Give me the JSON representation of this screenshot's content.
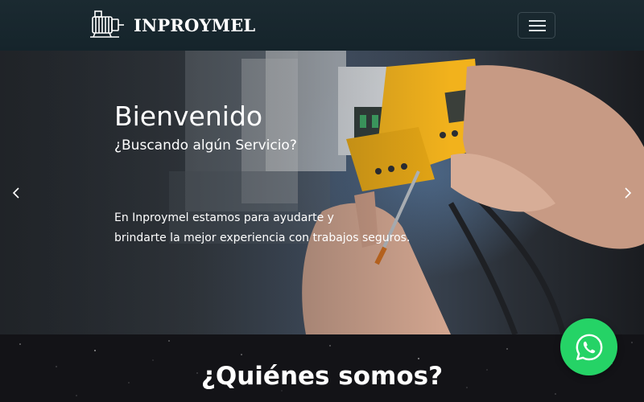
{
  "navbar": {
    "brand_name": "INPROYMEL",
    "logo_icon": "electric-motor-icon",
    "menu_icon": "hamburger-menu-icon"
  },
  "hero": {
    "title": "Bienvenido",
    "subtitle": "¿Buscando algún Servicio?",
    "text_line1": "En Inproymel estamos para ayudarte y",
    "text_line2": "brindarte la mejor experiencia con trabajos seguros.",
    "prev_icon": "chevron-left-icon",
    "next_icon": "chevron-right-icon"
  },
  "about": {
    "title": "¿Quiénes somos?"
  },
  "whatsapp": {
    "icon": "whatsapp-icon",
    "color": "#25d366"
  },
  "colors": {
    "navbar_bg": "#1b2a31",
    "device_yellow": "#f2b21c",
    "page_bg": "#131317"
  }
}
